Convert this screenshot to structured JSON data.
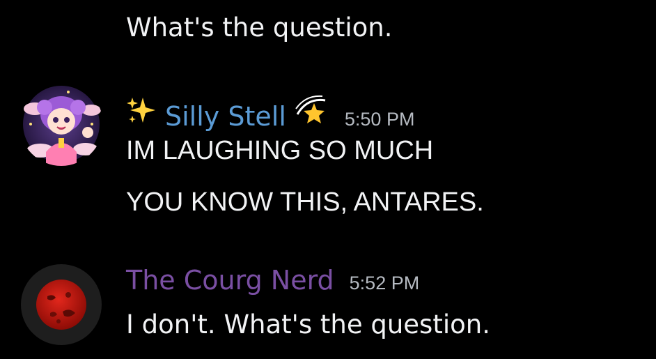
{
  "messages": [
    {
      "continued_text": "What's the question."
    },
    {
      "author": "Silly Stell",
      "author_color": "#5b9bd5",
      "timestamp": "5:50 PM",
      "avatar_icon": "anime-girl-avatar",
      "name_prefix_icon": "sparkles-icon",
      "name_suffix_icon": "dizzy-star-icon",
      "lines": [
        "IM LAUGHING SO MUCH",
        "YOU KNOW THIS, ANTARES."
      ]
    },
    {
      "author": "The Courg Nerd",
      "author_color": "#7a4fa3",
      "timestamp": "5:52 PM",
      "avatar_icon": "red-planet-avatar",
      "lines": [
        "I don't. What's the question."
      ]
    }
  ]
}
